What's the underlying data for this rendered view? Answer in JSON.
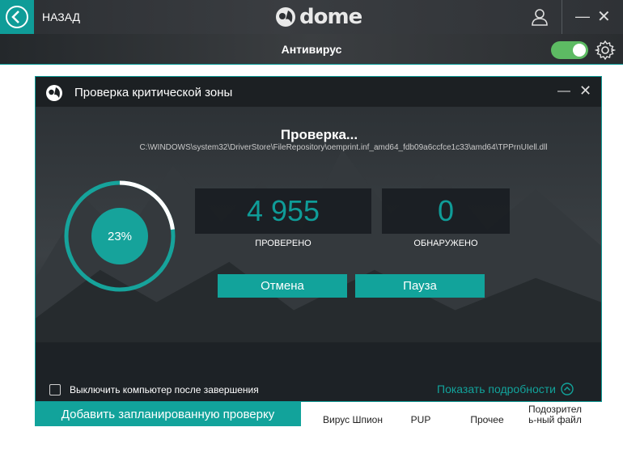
{
  "topbar": {
    "back_label": "НАЗАД",
    "logo_text": "dome"
  },
  "subbar": {
    "title": "Антивирус",
    "toggle_on": true
  },
  "dialog": {
    "title": "Проверка критической зоны",
    "scan_status": "Проверка...",
    "scan_path": "C:\\WINDOWS\\system32\\DriverStore\\FileRepository\\oemprint.inf_amd64_fdb09a6ccfce1c33\\amd64\\TPPrnUIell.dll",
    "progress_percent": 23,
    "progress_label": "23%",
    "checked_value": "4 955",
    "checked_label": "ПРОВЕРЕНО",
    "found_value": "0",
    "found_label": "ОБНАРУЖЕНО",
    "cancel_label": "Отмена",
    "pause_label": "Пауза",
    "shutdown_label": "Выключить компьютер после завершения",
    "details_label": "Показать подробности"
  },
  "background": {
    "schedule_button": "Добавить запланированную проверку",
    "tabs": [
      "Вирус Шпион",
      "PUP",
      "Прочее",
      "Подозрител ь-ный файл"
    ]
  },
  "colors": {
    "accent": "#12a39b",
    "toggle": "#5dbb63"
  }
}
